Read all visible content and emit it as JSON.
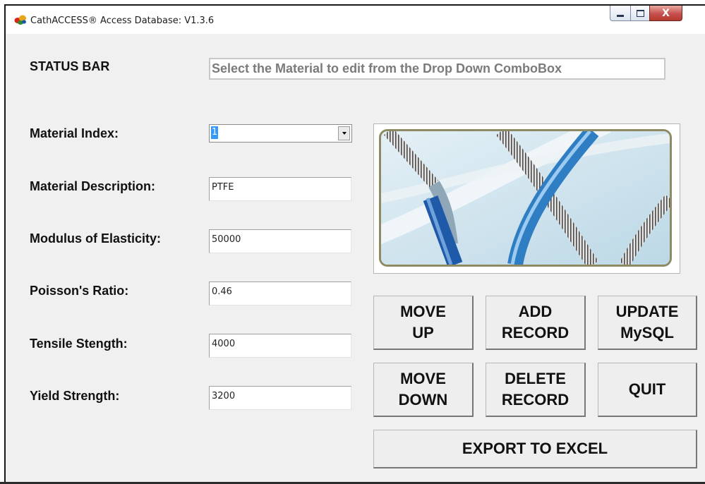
{
  "window": {
    "title": "CathACCESS® Access Database: V1.3.6",
    "close_glyph": "X"
  },
  "status": {
    "label": "STATUS BAR",
    "message": "Select the Material to edit from the Drop Down ComboBox"
  },
  "form": {
    "material_index": {
      "label": "Material Index:",
      "value": "1"
    },
    "material_description": {
      "label": "Material Description:",
      "value": "PTFE"
    },
    "modulus_of_elasticity": {
      "label": "Modulus of Elasticity:",
      "value": "50000"
    },
    "poissons_ratio": {
      "label": "Poisson's Ratio:",
      "value": "0.46"
    },
    "tensile_strength": {
      "label": "Tensile Stength:",
      "value": "4000"
    },
    "yield_strength": {
      "label": "Yield Strength:",
      "value": "3200"
    }
  },
  "buttons": {
    "move_up": [
      "MOVE",
      "UP"
    ],
    "add_record": [
      "ADD",
      "RECORD"
    ],
    "update_mysql": [
      "UPDATE",
      "MySQL"
    ],
    "move_down": [
      "MOVE",
      "DOWN"
    ],
    "delete_record": [
      "DELETE",
      "RECORD"
    ],
    "quit": [
      "QUIT"
    ],
    "export_excel": [
      "EXPORT TO EXCEL"
    ]
  },
  "icons": {
    "app": "app-logo-icon",
    "minimize": "minimize-icon",
    "maximize": "maximize-icon",
    "close": "close-icon",
    "dropdown": "chevron-down-icon"
  },
  "colors": {
    "selection": "#3399ff",
    "status_text": "#7b7b7b",
    "catheter_blue": "#1f5aa8"
  }
}
